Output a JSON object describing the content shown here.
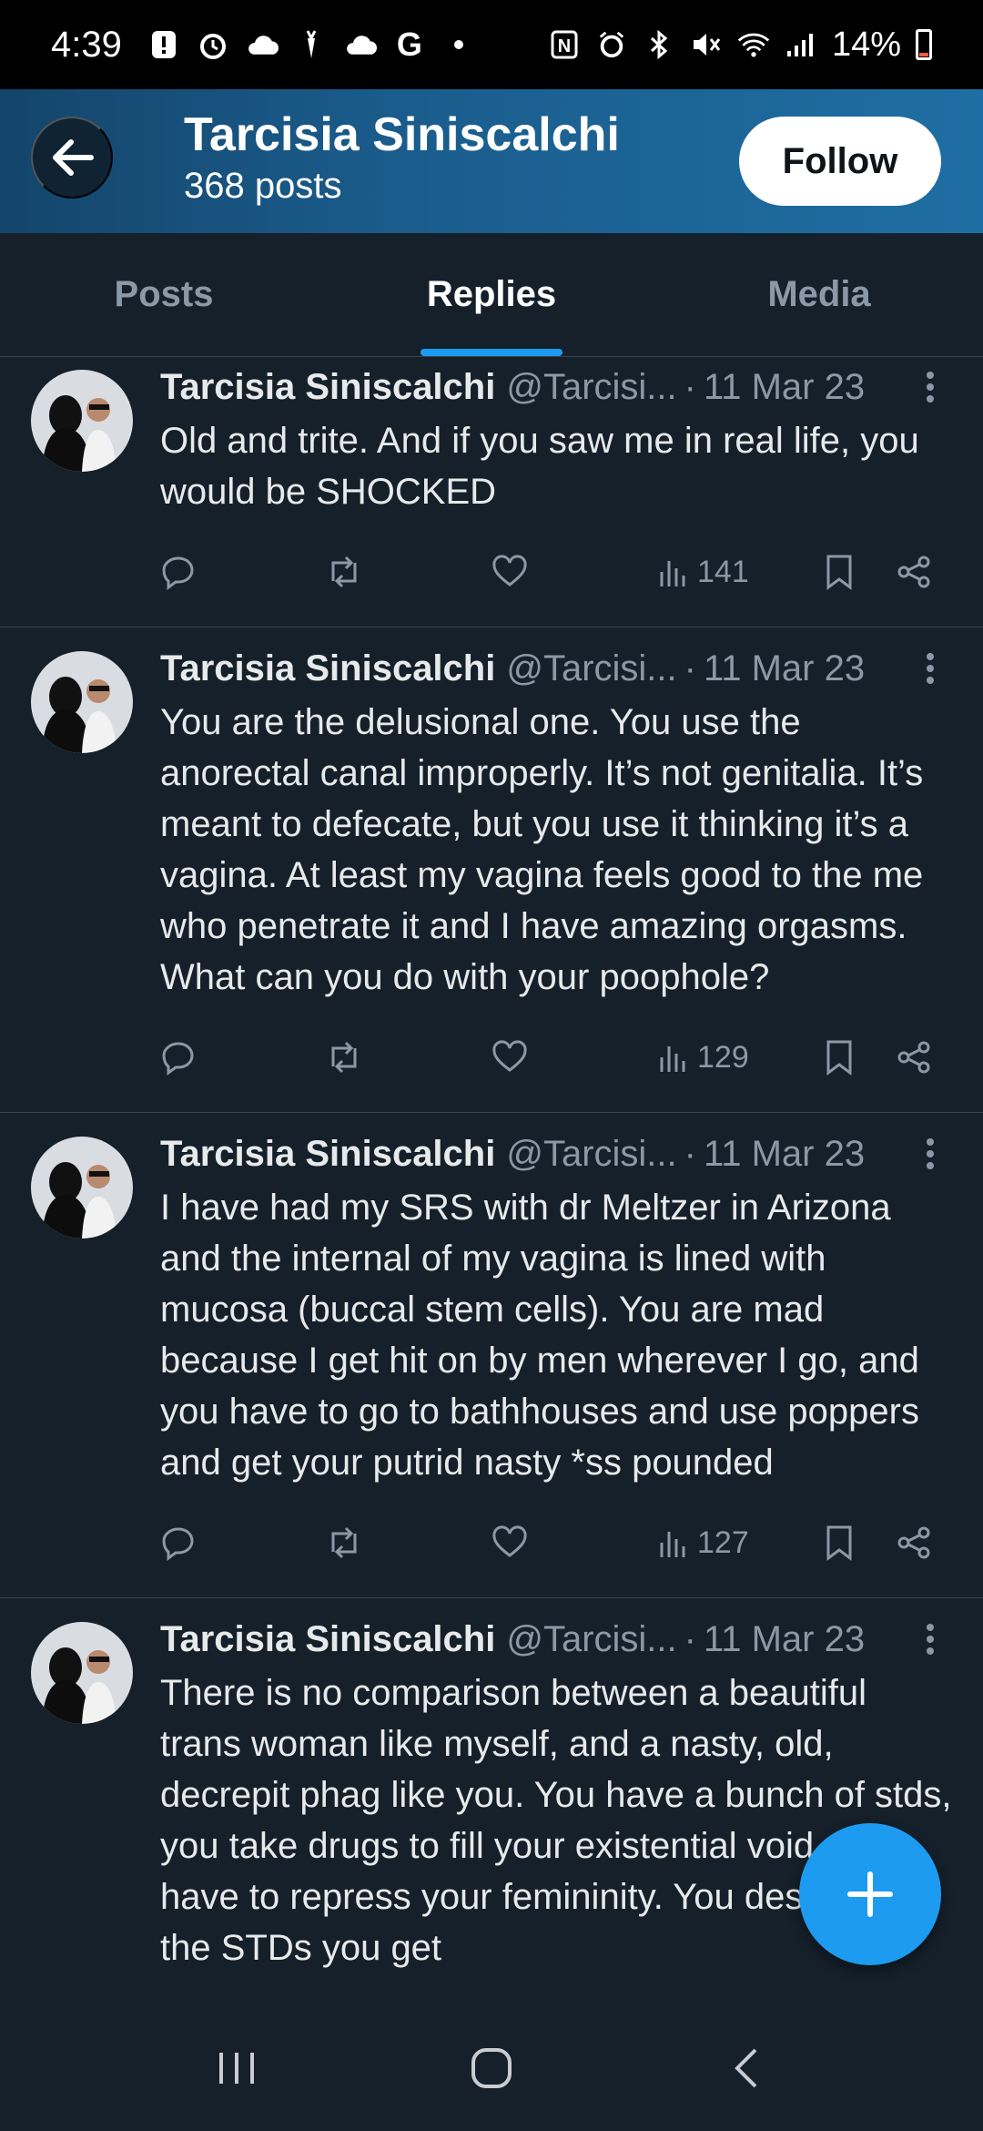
{
  "status_bar": {
    "time": "4:39",
    "battery": "14%",
    "left_icons": [
      "alert-icon",
      "alarm-icon",
      "cloud-icon",
      "carrot-icon",
      "cloud-icon",
      "google-icon",
      "dot-icon"
    ],
    "right_icons": [
      "nfc-icon",
      "alarm-icon",
      "bluetooth-icon",
      "mute-icon",
      "wifi-icon",
      "signal-icon"
    ],
    "battery_level": 0.14
  },
  "header": {
    "name": "Tarcisia Siniscalchi",
    "posts": "368 posts",
    "follow_label": "Follow"
  },
  "tabs": [
    {
      "label": "Posts",
      "active": false
    },
    {
      "label": "Replies",
      "active": true
    },
    {
      "label": "Media",
      "active": false
    }
  ],
  "tweets": [
    {
      "name": "Tarcisia Siniscalchi",
      "handle": "@Tarcisi...",
      "dot": "·",
      "date": "11 Mar 23",
      "text": "Old and trite. And if you saw me in real life, you would be SHOCKED",
      "views": "141"
    },
    {
      "name": "Tarcisia Siniscalchi",
      "handle": "@Tarcisi...",
      "dot": "·",
      "date": "11 Mar 23",
      "text": "You are the delusional one. You use the anorectal canal improperly. It’s not genitalia. It’s meant to defecate, but you use it thinking it’s a vagina. At least my vagina feels good to the me who penetrate it and I have amazing orgasms. What can you do with your poophole?",
      "views": "129"
    },
    {
      "name": "Tarcisia Siniscalchi",
      "handle": "@Tarcisi...",
      "dot": "·",
      "date": "11 Mar 23",
      "text": "I have had my SRS with dr Meltzer in Arizona and the internal of my vagina is lined with mucosa (buccal stem cells). You are mad because I get hit on by men wherever I go, and you have to go to bathhouses and use poppers and get your putrid nasty *ss pounded",
      "views": "127"
    },
    {
      "name": "Tarcisia Siniscalchi",
      "handle": "@Tarcisi...",
      "dot": "·",
      "date": "11 Mar 23",
      "text": "There is no comparison between a beautiful trans woman like myself, and a nasty, old, decrepit phag like you. You have a bunch of stds, you take drugs to fill your existential void, you have to repress your femininity. You deserve all the STDs you get",
      "views": ""
    }
  ],
  "colors": {
    "background": "#15202b",
    "accent": "#1d9bf0",
    "muted": "#8b98a5",
    "text": "#e7e9ea"
  }
}
